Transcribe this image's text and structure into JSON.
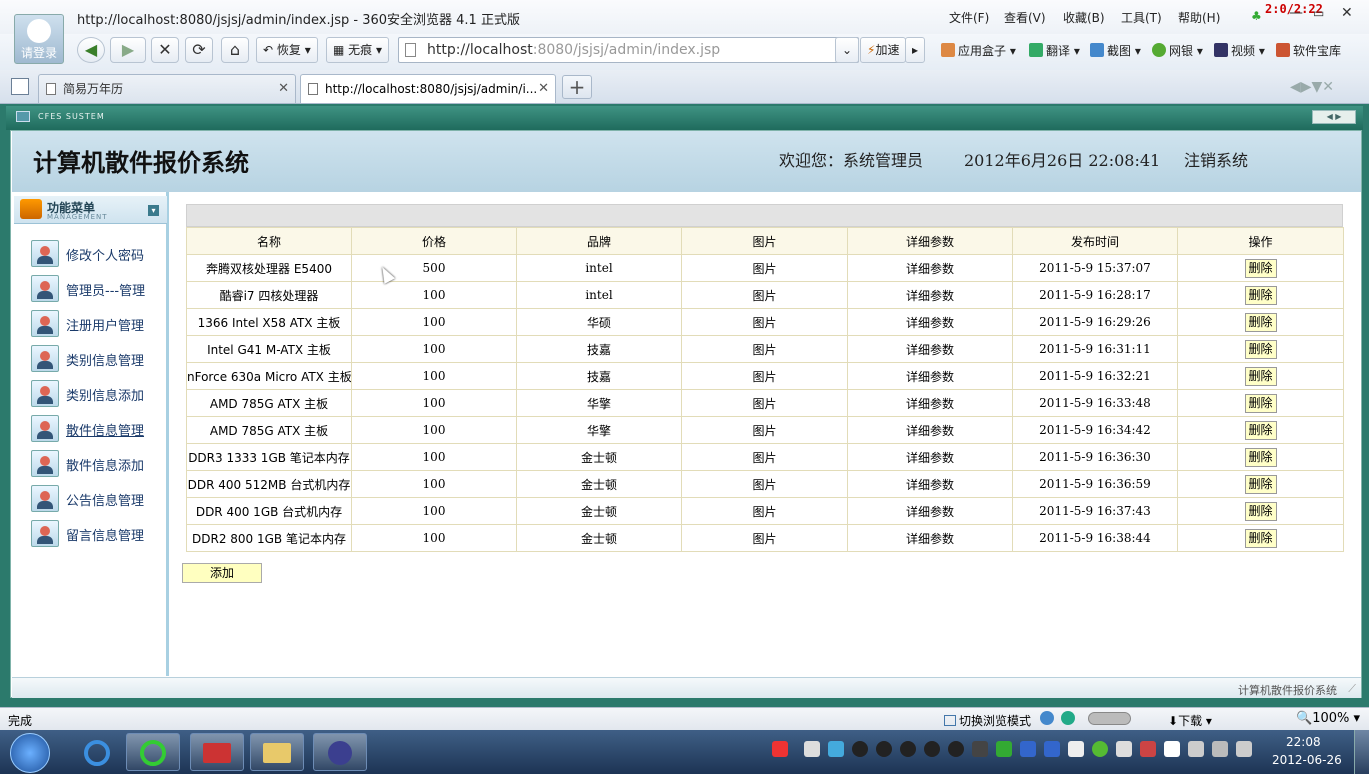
{
  "browser": {
    "window_title": "http://localhost:8080/jsjsj/admin/index.jsp - 360安全浏览器 4.1 正式版",
    "avatar_label": "请登录",
    "menu": [
      "文件(F)",
      "查看(V)",
      "收藏(B)",
      "工具(T)",
      "帮助(H)"
    ],
    "counter": "2:0/2:22",
    "restore_label": "恢复",
    "trace_label": "无痕",
    "address_host": "http://localhost",
    "address_path": ":8080/jsjsj/admin/index.jsp",
    "speedup_label": "加速",
    "extensions": [
      "应用盒子",
      "翻译",
      "截图",
      "网银",
      "视频",
      "软件宝库"
    ],
    "tabs": [
      {
        "label": "简易万年历",
        "active": false
      },
      {
        "label": "http://localhost:8080/jsjsj/admin/i...",
        "active": true
      }
    ],
    "page_strip_label": "CFES SUSTEM",
    "status_text": "完成",
    "switch_mode_label": "切换浏览模式",
    "download_label": "下载",
    "zoom": "100%"
  },
  "site": {
    "title": "计算机散件报价系统",
    "welcome": "欢迎您：系统管理员",
    "datetime": "2012年6月26日  22:08:41",
    "logout": "注销系统",
    "footer": "计算机散件报价系统"
  },
  "sidebar": {
    "title": "功能菜单",
    "subtitle": "MANAGEMENT",
    "items": [
      "修改个人密码",
      "管理员---管理",
      "注册用户管理",
      "类别信息管理",
      "类别信息添加",
      "散件信息管理",
      "散件信息添加",
      "公告信息管理",
      "留言信息管理"
    ]
  },
  "table": {
    "headers": [
      "名称",
      "价格",
      "品牌",
      "图片",
      "详细参数",
      "发布时间",
      "操作"
    ],
    "image_label": "图片",
    "detail_label": "详细参数",
    "delete_label": "删除",
    "rows": [
      {
        "name": "奔腾双核处理器  E5400",
        "price": "500",
        "brand": "intel",
        "time": "2011-5-9 15:37:07"
      },
      {
        "name": "酷睿i7 四核处理器",
        "price": "100",
        "brand": "intel",
        "time": "2011-5-9 16:28:17"
      },
      {
        "name": "1366 Intel X58 ATX 主板",
        "price": "100",
        "brand": "华硕",
        "time": "2011-5-9 16:29:26"
      },
      {
        "name": "Intel G41 M-ATX 主板",
        "price": "100",
        "brand": "技嘉",
        "time": "2011-5-9 16:31:11"
      },
      {
        "name": "nForce 630a Micro ATX 主板",
        "price": "100",
        "brand": "技嘉",
        "time": "2011-5-9 16:32:21"
      },
      {
        "name": "AMD 785G ATX 主板",
        "price": "100",
        "brand": "华擎",
        "time": "2011-5-9 16:33:48"
      },
      {
        "name": "AMD 785G ATX 主板",
        "price": "100",
        "brand": "华擎",
        "time": "2011-5-9 16:34:42"
      },
      {
        "name": "DDR3 1333 1GB 笔记本内存",
        "price": "100",
        "brand": "金士顿",
        "time": "2011-5-9 16:36:30"
      },
      {
        "name": "DDR 400 512MB 台式机内存",
        "price": "100",
        "brand": "金士顿",
        "time": "2011-5-9 16:36:59"
      },
      {
        "name": "DDR 400 1GB 台式机内存",
        "price": "100",
        "brand": "金士顿",
        "time": "2011-5-9 16:37:43"
      },
      {
        "name": "DDR2 800 1GB 笔记本内存",
        "price": "100",
        "brand": "金士顿",
        "time": "2011-5-9 16:38:44"
      }
    ],
    "add_label": "添加"
  },
  "taskbar": {
    "time": "22:08",
    "date": "2012-06-26"
  }
}
